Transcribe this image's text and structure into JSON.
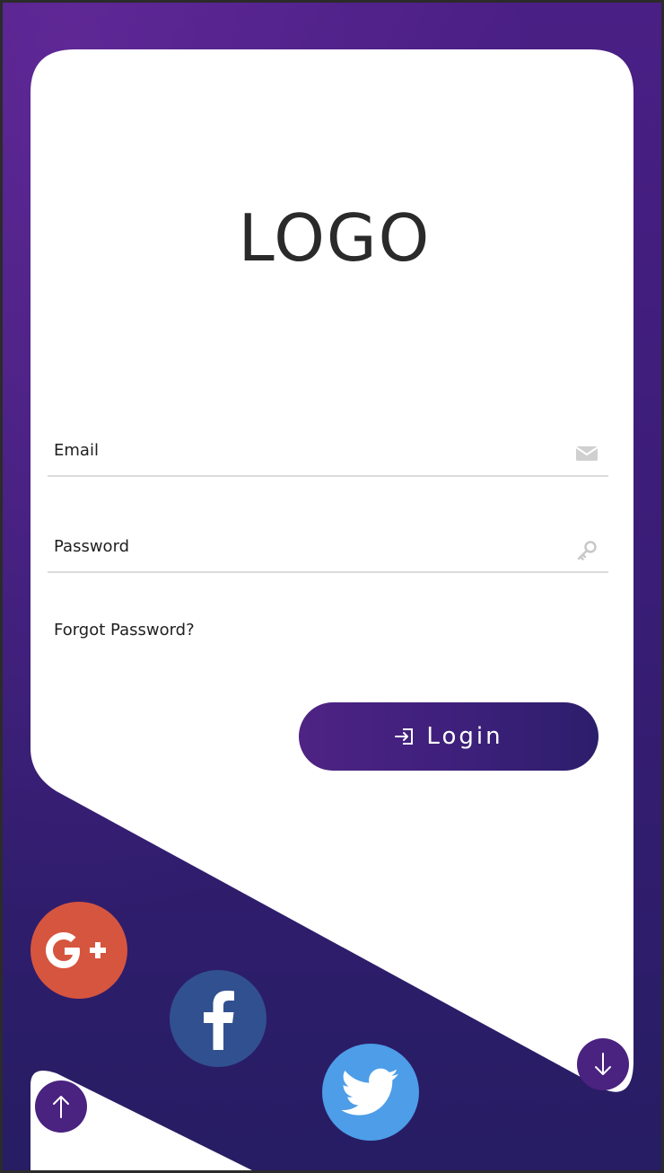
{
  "logo": {
    "text": "LOGO"
  },
  "form": {
    "email_label": "Email",
    "password_label": "Password",
    "forgot_label": "Forgot Password?",
    "login_label": "Login"
  },
  "icons": {
    "email": "envelope-icon",
    "password": "key-icon",
    "login": "sign-in-icon",
    "gplus": "google-plus-icon",
    "facebook": "facebook-icon",
    "twitter": "twitter-bird-icon",
    "down": "arrow-down-icon",
    "up": "arrow-up-icon"
  },
  "colors": {
    "brand_purple": "#4a2280",
    "google_plus": "#d6553f",
    "facebook": "#31508f",
    "twitter": "#4d9de8"
  }
}
